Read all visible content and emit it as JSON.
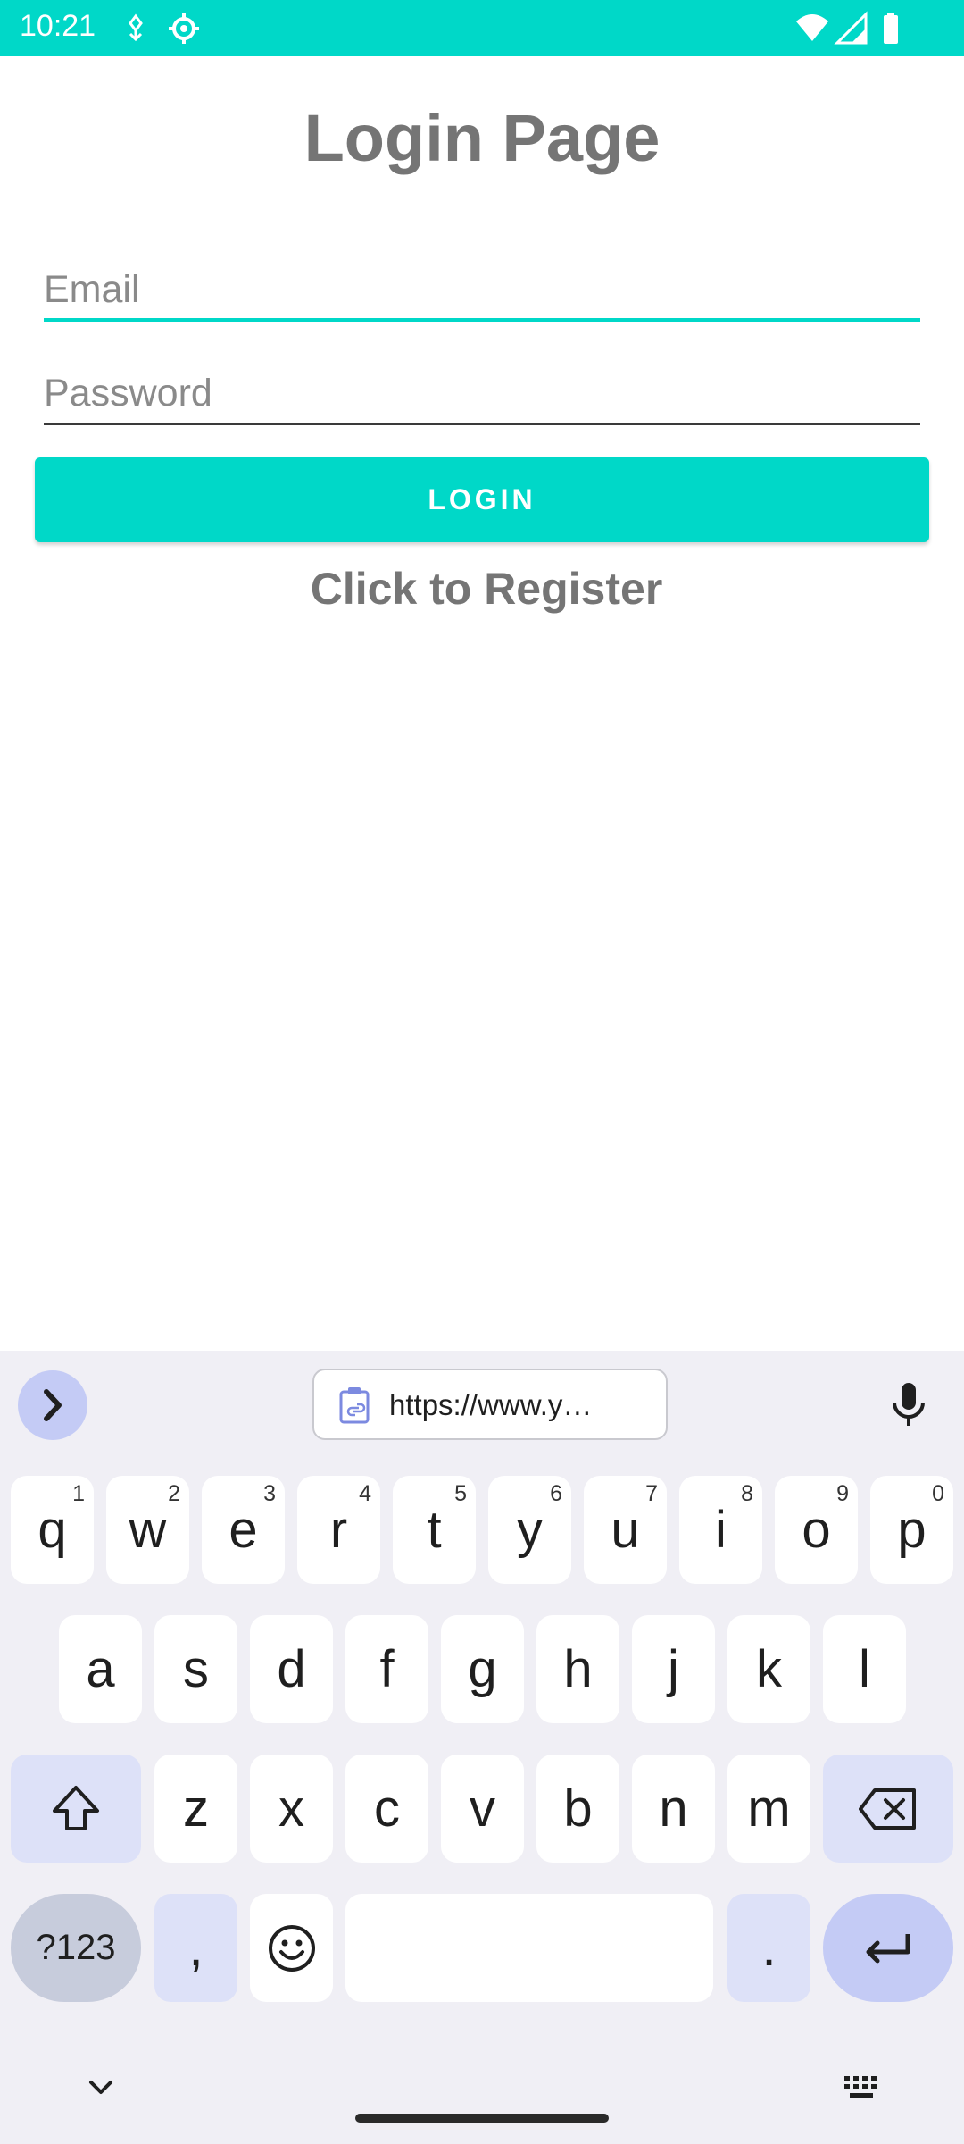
{
  "status_bar": {
    "time": "10:21",
    "icons": [
      "usb-debug-icon",
      "settings-gear-icon",
      "wifi-icon",
      "signal-icon",
      "battery-icon"
    ],
    "color": "#00d8c8"
  },
  "app": {
    "title": "Login Page",
    "email_placeholder": "Email",
    "password_placeholder": "Password",
    "login_label": "LOGIN",
    "register_label": "Click to Register",
    "accent": "#00d8c8"
  },
  "keyboard": {
    "clipboard_text": "https://www.y…",
    "row1": [
      {
        "l": "q",
        "h": "1"
      },
      {
        "l": "w",
        "h": "2"
      },
      {
        "l": "e",
        "h": "3"
      },
      {
        "l": "r",
        "h": "4"
      },
      {
        "l": "t",
        "h": "5"
      },
      {
        "l": "y",
        "h": "6"
      },
      {
        "l": "u",
        "h": "7"
      },
      {
        "l": "i",
        "h": "8"
      },
      {
        "l": "o",
        "h": "9"
      },
      {
        "l": "p",
        "h": "0"
      }
    ],
    "row2": [
      "a",
      "s",
      "d",
      "f",
      "g",
      "h",
      "j",
      "k",
      "l"
    ],
    "row3": [
      "z",
      "x",
      "c",
      "v",
      "b",
      "n",
      "m"
    ],
    "symbols_label": "?123",
    "comma": ",",
    "period": "."
  }
}
